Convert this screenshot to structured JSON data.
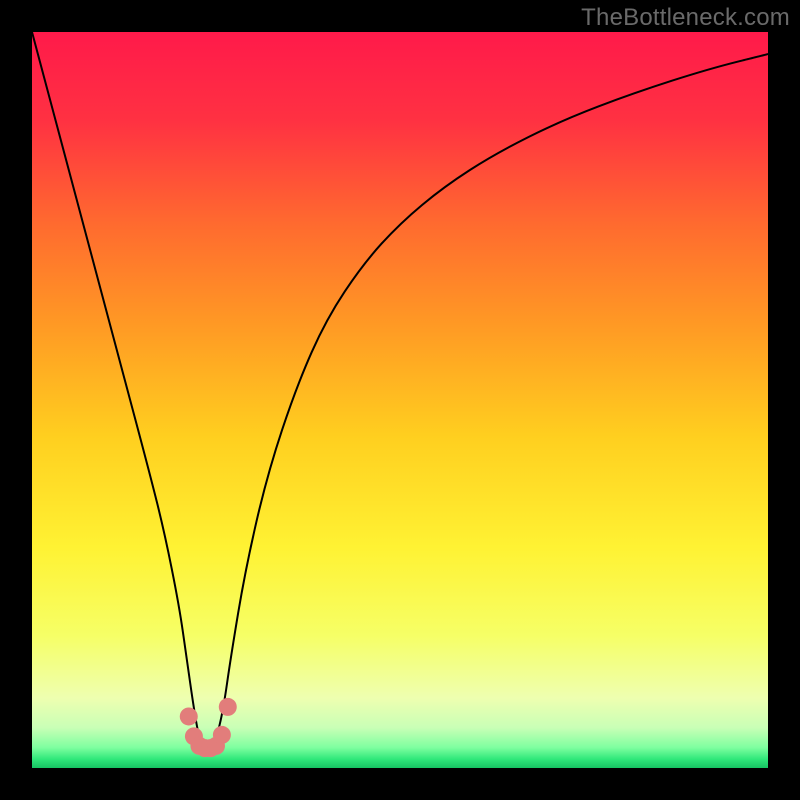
{
  "watermark": "TheBottleneck.com",
  "chart_data": {
    "type": "line",
    "title": "",
    "xlabel": "",
    "ylabel": "",
    "xlim": [
      0,
      100
    ],
    "ylim": [
      0,
      100
    ],
    "grid": false,
    "series": [
      {
        "name": "bottleneck-curve",
        "x": [
          0,
          4,
          8,
          12,
          16,
          18,
          20,
          21,
          22,
          22.75,
          23.5,
          24.25,
          25,
          26,
          27,
          29,
          32,
          36,
          40,
          45,
          50,
          56,
          63,
          72,
          82,
          92,
          100
        ],
        "values": [
          100,
          85,
          70,
          55,
          40,
          32,
          22,
          15,
          8,
          3.8,
          2.6,
          2.6,
          3.8,
          8,
          15,
          27,
          40,
          52,
          61,
          68.5,
          74,
          79,
          83.5,
          88,
          91.8,
          95,
          97
        ]
      }
    ],
    "markers": {
      "name": "highlight-points",
      "color": "#e27d7b",
      "x": [
        21.3,
        22.0,
        22.75,
        23.5,
        24.25,
        25.0,
        25.8,
        26.6
      ],
      "values": [
        7.0,
        4.3,
        3.0,
        2.7,
        2.7,
        3.0,
        4.5,
        8.3
      ]
    },
    "background_gradient": {
      "stops": [
        {
          "offset": 0.0,
          "color": "#ff1a4a"
        },
        {
          "offset": 0.12,
          "color": "#ff3142"
        },
        {
          "offset": 0.26,
          "color": "#ff6a2f"
        },
        {
          "offset": 0.4,
          "color": "#ff9a24"
        },
        {
          "offset": 0.55,
          "color": "#ffcf1f"
        },
        {
          "offset": 0.7,
          "color": "#fff233"
        },
        {
          "offset": 0.82,
          "color": "#f6ff66"
        },
        {
          "offset": 0.905,
          "color": "#eeffb0"
        },
        {
          "offset": 0.945,
          "color": "#c9ffb6"
        },
        {
          "offset": 0.972,
          "color": "#7fffa0"
        },
        {
          "offset": 0.988,
          "color": "#2fe87a"
        },
        {
          "offset": 1.0,
          "color": "#17c463"
        }
      ]
    }
  }
}
